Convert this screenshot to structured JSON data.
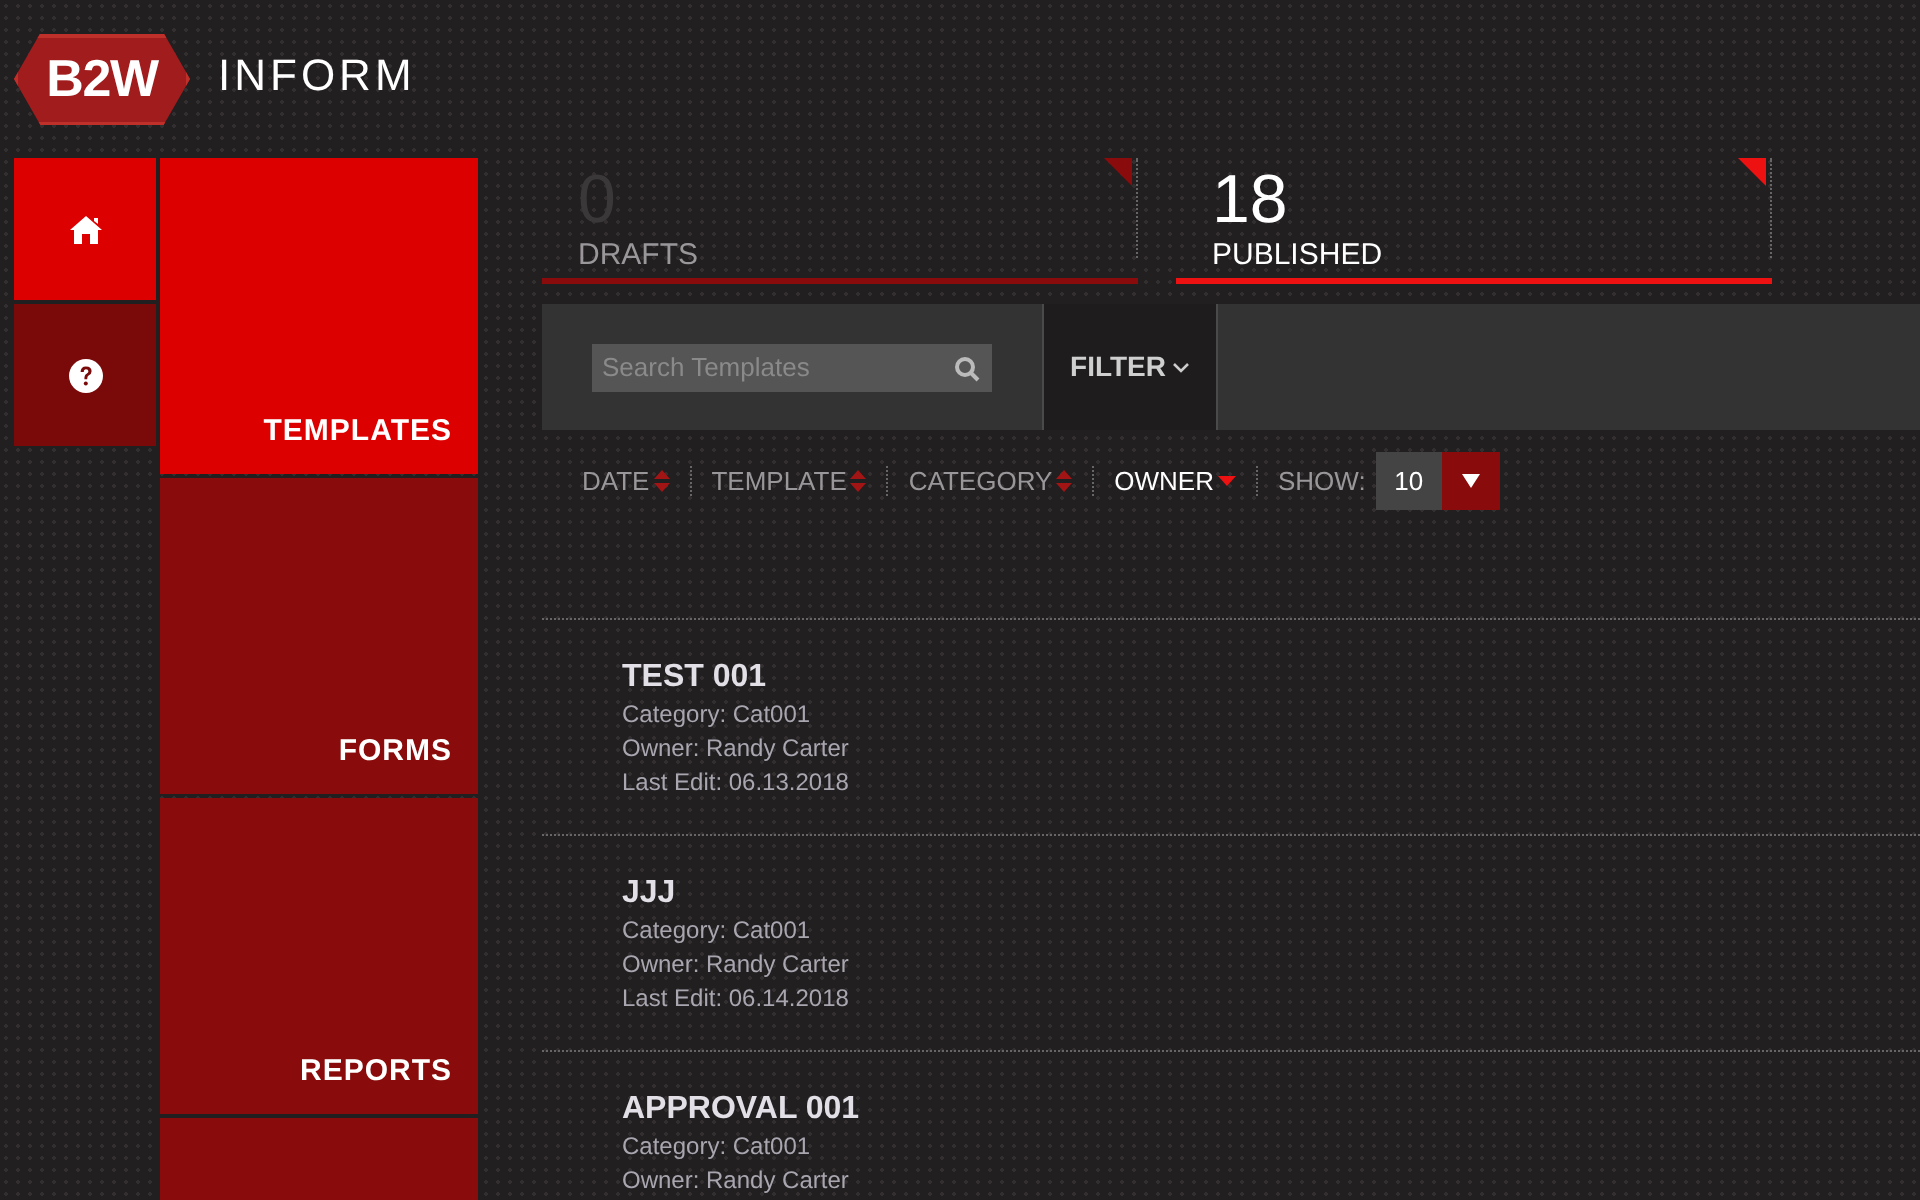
{
  "header": {
    "logo_text": "B2W",
    "app_name": "INFORM"
  },
  "icon_nav": [
    {
      "kind": "home",
      "selected": true
    },
    {
      "kind": "help",
      "selected": false
    }
  ],
  "nav": [
    {
      "label": "TEMPLATES",
      "selected": true
    },
    {
      "label": "FORMS",
      "selected": false
    },
    {
      "label": "REPORTS",
      "selected": false
    },
    {
      "selected": false
    }
  ],
  "stats": [
    {
      "count": "0",
      "label": "DRAFTS",
      "selected": false
    },
    {
      "count": "18",
      "label": "PUBLISHED",
      "selected": true
    }
  ],
  "toolbar": {
    "search": {
      "placeholder": "Search Templates"
    },
    "filter": "FILTER"
  },
  "sort": [
    {
      "label": "DATE",
      "selected": false
    },
    {
      "label": "TEMPLATE",
      "selected": false
    },
    {
      "label": "CATEGORY",
      "selected": false
    },
    {
      "label": "OWNER",
      "selected": true
    }
  ],
  "show": {
    "label": "SHOW:",
    "value": "10"
  },
  "templates": [
    {
      "name": "TEST 001",
      "lines": [
        "Category: Cat001",
        "Owner: Randy Carter",
        "Last Edit: 06.13.2018"
      ]
    },
    {
      "name": "JJJ",
      "lines": [
        "Category: Cat001",
        "Owner: Randy Carter",
        "Last Edit: 06.14.2018"
      ]
    },
    {
      "name": "APPROVAL 001",
      "lines": [
        "Category: Cat001",
        "Owner: Randy Carter"
      ]
    }
  ]
}
